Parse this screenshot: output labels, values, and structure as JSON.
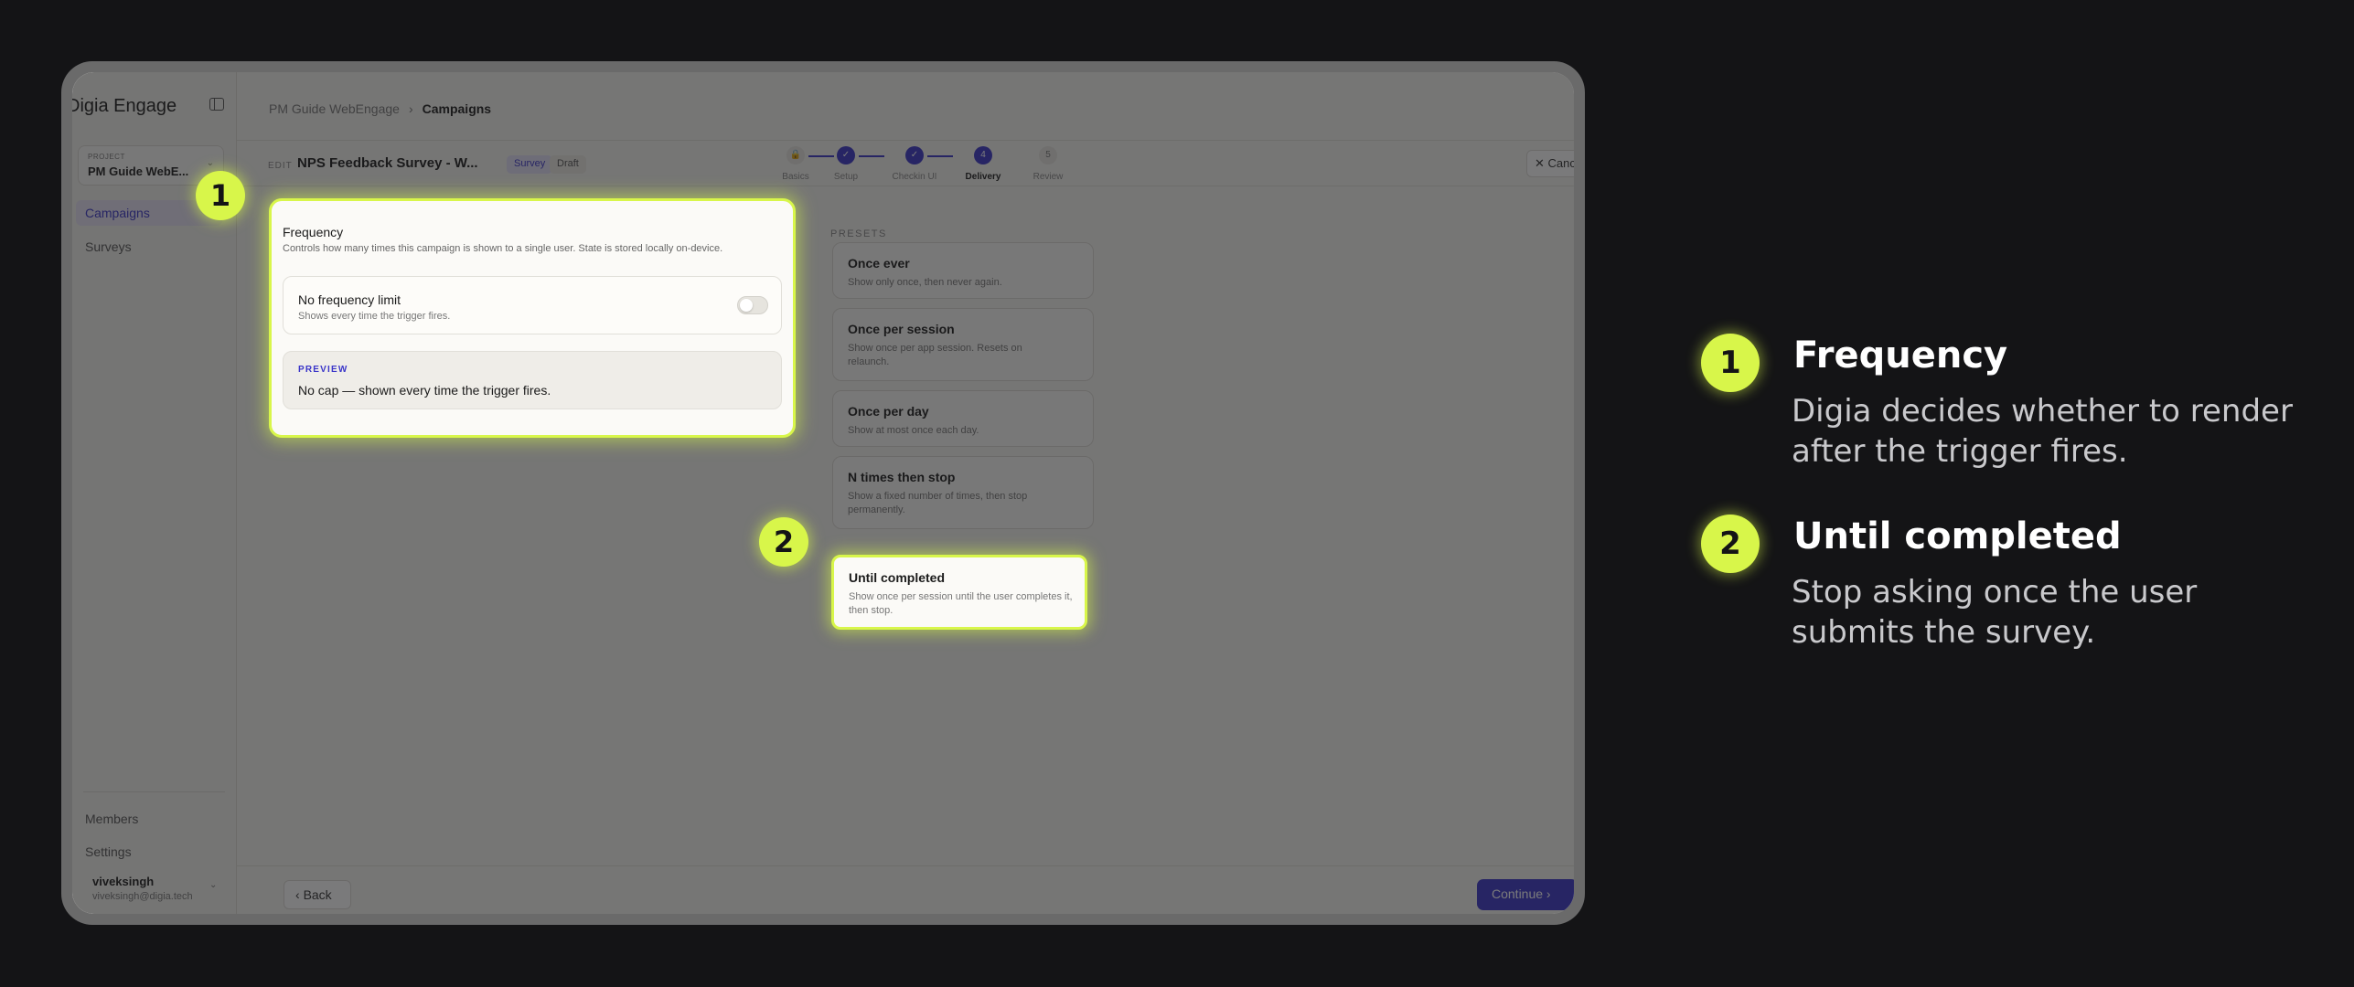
{
  "sidebar": {
    "brand": "Digia Engage",
    "project_label": "PROJECT",
    "project_name": "PM Guide WebE...",
    "nav": [
      {
        "label": "Campaigns",
        "active": true
      },
      {
        "label": "Surveys",
        "active": false
      }
    ],
    "bottom_nav": [
      {
        "label": "Members"
      },
      {
        "label": "Settings"
      }
    ],
    "user": {
      "name": "viveksingh",
      "email": "viveksingh@digia.tech"
    }
  },
  "breadcrumb": {
    "root": "PM Guide WebEngage",
    "current": "Campaigns"
  },
  "campaign": {
    "edit_label": "EDIT",
    "title": "NPS Feedback Survey - W...",
    "type_badge": "Survey",
    "status_badge": "Draft"
  },
  "stepper": {
    "steps": [
      {
        "label": "Basics",
        "state": "locked"
      },
      {
        "label": "Setup",
        "state": "done"
      },
      {
        "label": "Checkin UI",
        "state": "done"
      },
      {
        "label": "Delivery",
        "state": "current",
        "number": "4"
      },
      {
        "label": "Review",
        "state": "todo",
        "number": "5"
      }
    ]
  },
  "cancel_label": "Cancel",
  "frequency": {
    "title": "Frequency",
    "description": "Controls how many times this campaign is shown to a single user. State is stored locally on-device.",
    "no_limit": {
      "title": "No frequency limit",
      "description": "Shows every time the trigger fires.",
      "enabled": false
    },
    "preview": {
      "label": "PREVIEW",
      "text": "No cap — shown every time the trigger fires."
    }
  },
  "presets": {
    "label": "PRESETS",
    "items": [
      {
        "title": "Once ever",
        "description": "Show only once, then never again."
      },
      {
        "title": "Once per session",
        "description": "Show once per app session. Resets on relaunch."
      },
      {
        "title": "Once per day",
        "description": "Show at most once each day."
      },
      {
        "title": "N times then stop",
        "description": "Show a fixed number of times, then stop permanently."
      },
      {
        "title": "Until completed",
        "description": "Show once per session until the user completes it, then stop."
      }
    ]
  },
  "footer": {
    "back_label": "Back",
    "continue_label": "Continue"
  },
  "annotations": [
    {
      "number": "1",
      "title": "Frequency",
      "description": "Digia decides whether to render after the trigger fires."
    },
    {
      "number": "2",
      "title": "Until completed",
      "description": "Stop asking once the user submits the survey."
    }
  ],
  "colors": {
    "accent": "#d8f64a",
    "brand": "#3b36c9",
    "background": "#141416"
  }
}
